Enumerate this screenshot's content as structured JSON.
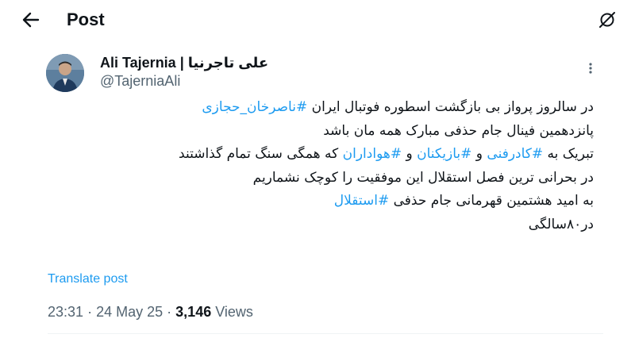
{
  "header": {
    "title": "Post",
    "back_icon": "arrow-left-icon",
    "grok_icon": "grok-icon"
  },
  "author": {
    "display_name": "Ali Tajernia | علی تاجرنیا",
    "handle": "@TajerniaAli",
    "avatar": "profile-photo"
  },
  "tweet": {
    "lines": [
      [
        {
          "text": "در سالروز پرواز بی بازگشت اسطوره فوتبال ایران ",
          "hashtag": false
        },
        {
          "text": "#ناصرخان_حجازی",
          "hashtag": true
        }
      ],
      [
        {
          "text": "پانزدهمین فینال جام حذفی مبارک همه مان باشد",
          "hashtag": false
        }
      ],
      [
        {
          "text": "تبریک به ",
          "hashtag": false
        },
        {
          "text": "#کادرفنی",
          "hashtag": true
        },
        {
          "text": " و ",
          "hashtag": false
        },
        {
          "text": "#بازیکنان",
          "hashtag": true
        },
        {
          "text": " و ",
          "hashtag": false
        },
        {
          "text": "#هواداران",
          "hashtag": true
        },
        {
          "text": " که همگی سنگ تمام گذاشتند",
          "hashtag": false
        }
      ],
      [
        {
          "text": "در بحرانی ترین فصل استقلال این موفقیت را کوچک نشماریم",
          "hashtag": false
        }
      ],
      [
        {
          "text": "به امید هشتمین قهرمانی جام حذفی ",
          "hashtag": false
        },
        {
          "text": "#استقلال",
          "hashtag": true
        }
      ],
      [
        {
          "text": "در۸۰سالگی",
          "hashtag": false
        }
      ]
    ]
  },
  "translate_label": "Translate post",
  "meta": {
    "time": "23:31",
    "separator": "·",
    "date": "24 May 25",
    "views_count": "3,146",
    "views_label": "Views"
  },
  "colors": {
    "accent": "#1d9bf0",
    "text": "#0f1419",
    "secondary": "#536471"
  }
}
